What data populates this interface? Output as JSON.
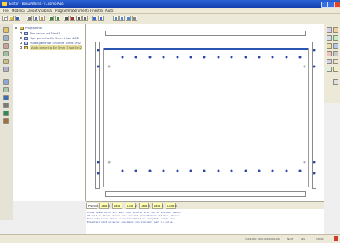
{
  "window": {
    "title": "Editor - BonusWorks - [Cosmo Ago]",
    "accent": "#1e4cc4"
  },
  "menu": [
    "File",
    "Modifica",
    "Layout",
    "Visibilità",
    "Programma",
    "Strumenti",
    "Finestra",
    "Aiuto"
  ],
  "tree": {
    "root": "Programma",
    "items": [
      "Non sense hsd3 irsd1",
      "Tipo generico 4in 5mm 3 irsd 4r52",
      "Vuoto generico 4in 5mm 3 irsd 4r52",
      "Vuoto generico 4in 5mm 3 irsd 4r52"
    ]
  },
  "tabs": [
    "Piscolo",
    "Lato 0",
    "Lato 1",
    "Lato 2",
    "Lato 3",
    "Lato 4",
    "Lato 5"
  ],
  "log": [
    "Lorem ipsum dolor sit amet cons adipisc elit sed do eiusmod tempor",
    "Ut enim ad minim veniam quis nostrud exercitation ullamco laboris",
    "Duis aute irure dolor in reprehenderit in voluptate velit esse",
    "Excepteur sint occaecat cupidatat non proident sunt in culpa"
  ],
  "status": {
    "coords": "100:1000 1000:100 1000:100",
    "mode": "NUM",
    "ins": "INS",
    "time": "18:42"
  }
}
